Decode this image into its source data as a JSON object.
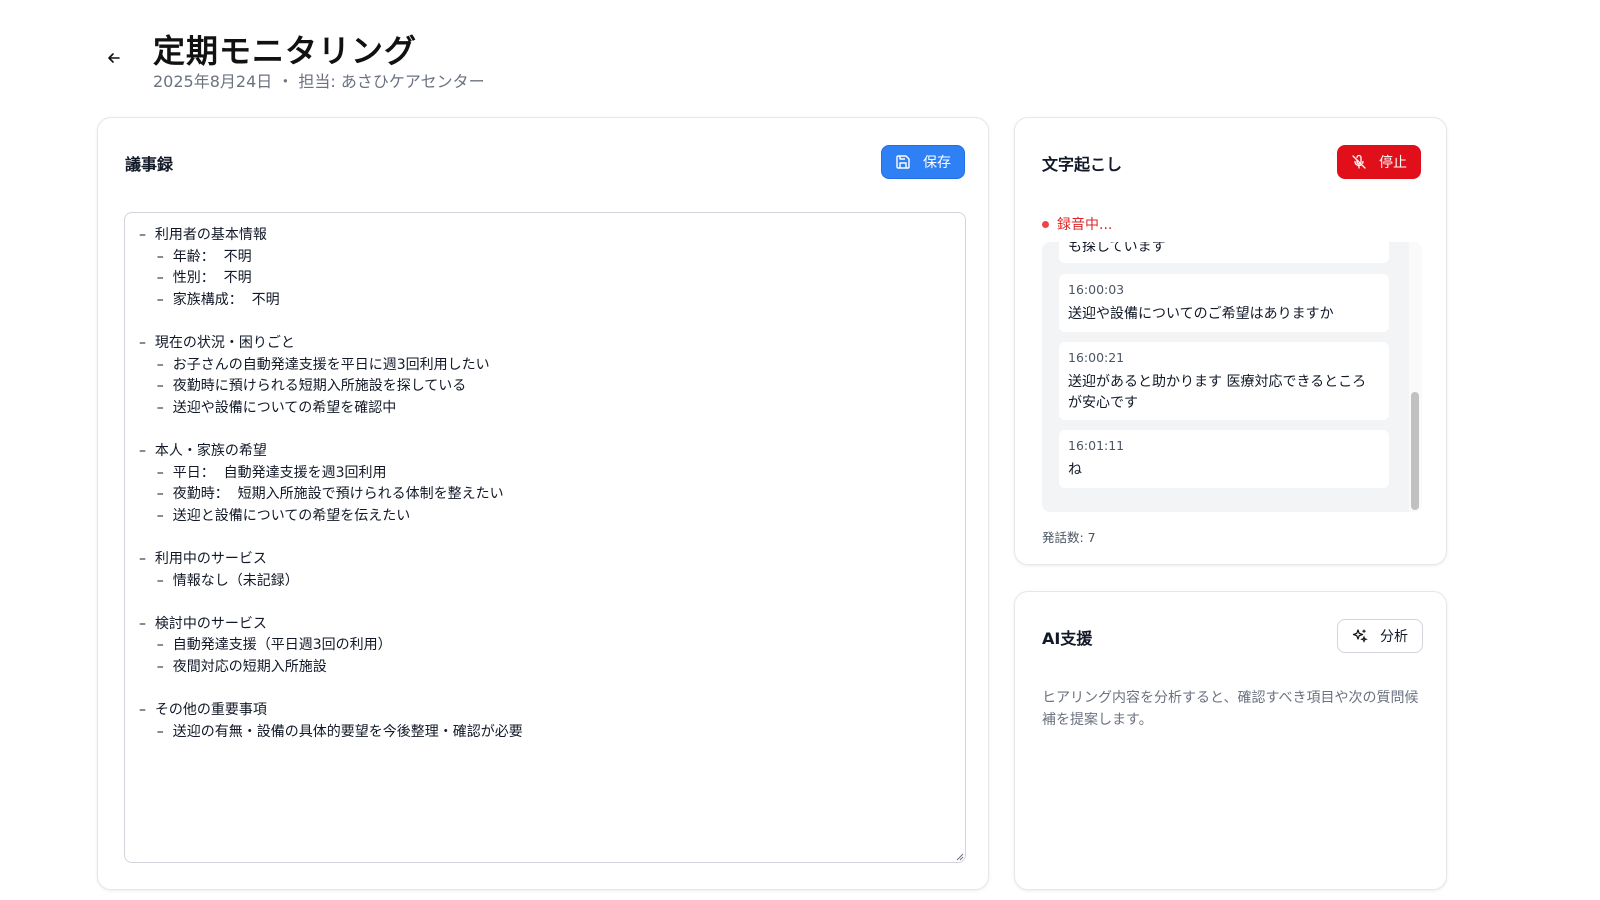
{
  "header": {
    "title": "定期モニタリング",
    "subtitle": "2025年8月24日 ・ 担当: あさひケアセンター"
  },
  "minutes": {
    "title": "議事録",
    "save_label": "保存",
    "text": "–  利用者の基本情報\n    –  年齢：  不明\n    –  性別：  不明\n    –  家族構成：  不明\n\n–  現在の状況・困りごと\n    –  お子さんの自動発達支援を平日に週3回利用したい\n    –  夜勤時に預けられる短期入所施設を探している\n    –  送迎や設備についての希望を確認中\n\n–  本人・家族の希望\n    –  平日：  自動発達支援を週3回利用\n    –  夜勤時：  短期入所施設で預けられる体制を整えたい\n    –  送迎と設備についての希望を伝えたい\n\n–  利用中のサービス\n    –  情報なし（未記録）\n\n–  検討中のサービス\n    –  自動発達支援（平日週3回の利用）\n    –  夜間対応の短期入所施設\n\n–  その他の重要事項\n    –  送迎の有無・設備の具体的要望を今後整理・確認が必要"
  },
  "transcript": {
    "title": "文字起こし",
    "stop_label": "停止",
    "status": "録音中...",
    "messages": [
      {
        "time": "",
        "text": "も探しています"
      },
      {
        "time": "16:00:03",
        "text": "送迎や設備についてのご希望はありますか"
      },
      {
        "time": "16:00:21",
        "text": "送迎があると助かります 医療対応できるところが安心です"
      },
      {
        "time": "16:01:11",
        "text": "ね"
      }
    ],
    "count": "発話数: 7"
  },
  "ai": {
    "title": "AI支援",
    "analyze_label": "分析",
    "description": "ヒアリング内容を分析すると、確認すべき項目や次の質問候補を提案します。"
  },
  "colors": {
    "primary": "#2f7ff5",
    "danger": "#e00f1a",
    "recording": "#dc2626"
  }
}
